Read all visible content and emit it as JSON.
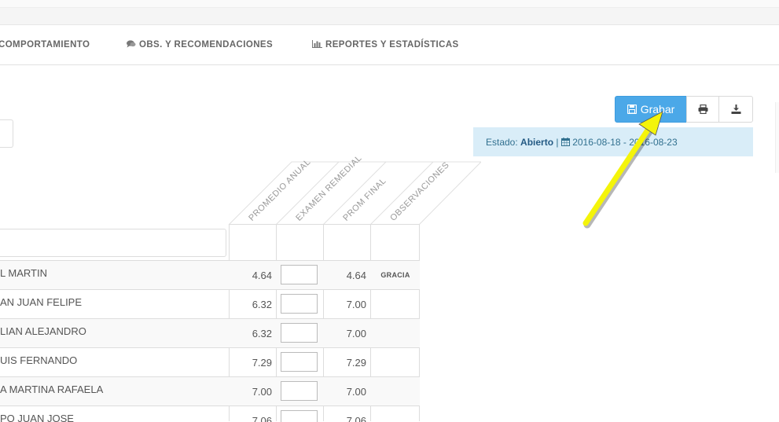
{
  "tabs": [
    {
      "label": "COMPORTAMIENTO",
      "icon": ""
    },
    {
      "label": "OBS. Y RECOMENDACIONES",
      "icon": "comments-icon"
    },
    {
      "label": "REPORTES Y ESTADÍSTICAS",
      "icon": "bar-chart-icon"
    }
  ],
  "toolbar": {
    "save_label": "Grabar",
    "save_icon": "save-icon",
    "print_icon": "print-icon",
    "download_icon": "download-icon",
    "accent": "#4ba8e8"
  },
  "status": {
    "label": "Estado:",
    "value": "Abierto",
    "separator": "|",
    "date_range": "2016-08-18 - 2016-08-23"
  },
  "table": {
    "headers": [
      "PROMEDIO ANUAL",
      "EXAMEN REMEDIAL",
      "PROM FINAL",
      "OBSERVACIONES"
    ],
    "rows": [
      {
        "name": "L MARTIN",
        "promedio": "4.64",
        "final": "4.64",
        "obs": "GRACIA"
      },
      {
        "name": "AN JUAN FELIPE",
        "promedio": "6.32",
        "final": "7.00",
        "obs": ""
      },
      {
        "name": "LIAN ALEJANDRO",
        "promedio": "6.32",
        "final": "7.00",
        "obs": ""
      },
      {
        "name": "UIS FERNANDO",
        "promedio": "7.29",
        "final": "7.29",
        "obs": ""
      },
      {
        "name": "A MARTINA RAFAELA",
        "promedio": "7.00",
        "final": "7.00",
        "obs": ""
      },
      {
        "name": "PO JUAN JOSE",
        "promedio": "7.06",
        "final": "7.06",
        "obs": ""
      }
    ]
  }
}
